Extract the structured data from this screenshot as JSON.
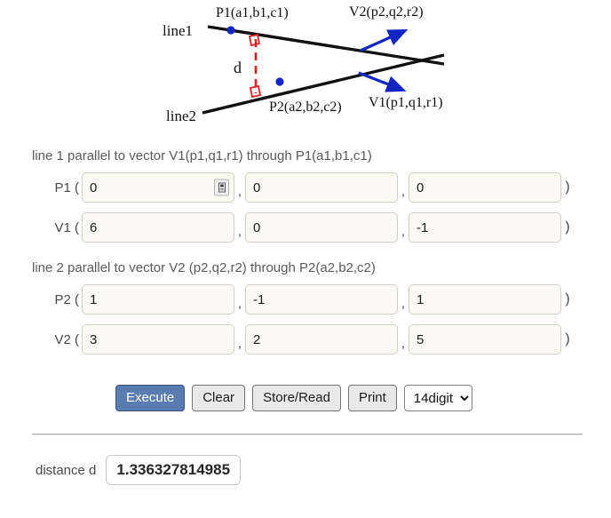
{
  "diagram": {
    "alt": "two skew lines in 3D with shortest distance d between them",
    "labels": {
      "line1": "line1",
      "line2": "line2",
      "p1": "P",
      "p1_sub": "1",
      "p1_args": "(a",
      "p1_full": "P1(a1,b1,c1)",
      "p2_full": "P2(a2,b2,c2)",
      "v1_full": "V1(p1,q1,r1)",
      "v2_full": "V2(p2,q2,r2)",
      "distance": "d"
    },
    "colors": {
      "line": "#111111",
      "point": "#1226c4",
      "vector": "#1226c4",
      "distance": "#e02020"
    }
  },
  "form": {
    "section1": {
      "description": "line 1 parallel to vector V1(p1,q1,r1) through P1(a1,b1,c1)",
      "rows": [
        {
          "label": "P1 (",
          "close": ")",
          "values": [
            "0",
            "0",
            "0"
          ],
          "has_autofill_icon": true
        },
        {
          "label": "V1 (",
          "close": ")",
          "values": [
            "6",
            "0",
            "-1"
          ],
          "has_autofill_icon": false
        }
      ]
    },
    "section2": {
      "description": "line 2 parallel to vector V2 (p2,q2,r2) through P2(a2,b2,c2)",
      "rows": [
        {
          "label": "P2 (",
          "close": ")",
          "values": [
            "1",
            "-1",
            "1"
          ],
          "has_autofill_icon": false
        },
        {
          "label": "V2 (",
          "close": ")",
          "values": [
            "3",
            "2",
            "5"
          ],
          "has_autofill_icon": false
        }
      ]
    },
    "comma": ","
  },
  "buttons": {
    "execute": "Execute",
    "clear": "Clear",
    "store_read": "Store/Read",
    "print": "Print",
    "digits_selected": "14digit",
    "digits_options": [
      "14digit"
    ]
  },
  "result": {
    "label": "distance d",
    "value": "1.336327814985"
  },
  "colors": {
    "execute_bg": "#5b7cb0",
    "button_bg": "#e9e9e9",
    "input_bg": "#fbfbf4",
    "text": "#3b3b3b"
  }
}
